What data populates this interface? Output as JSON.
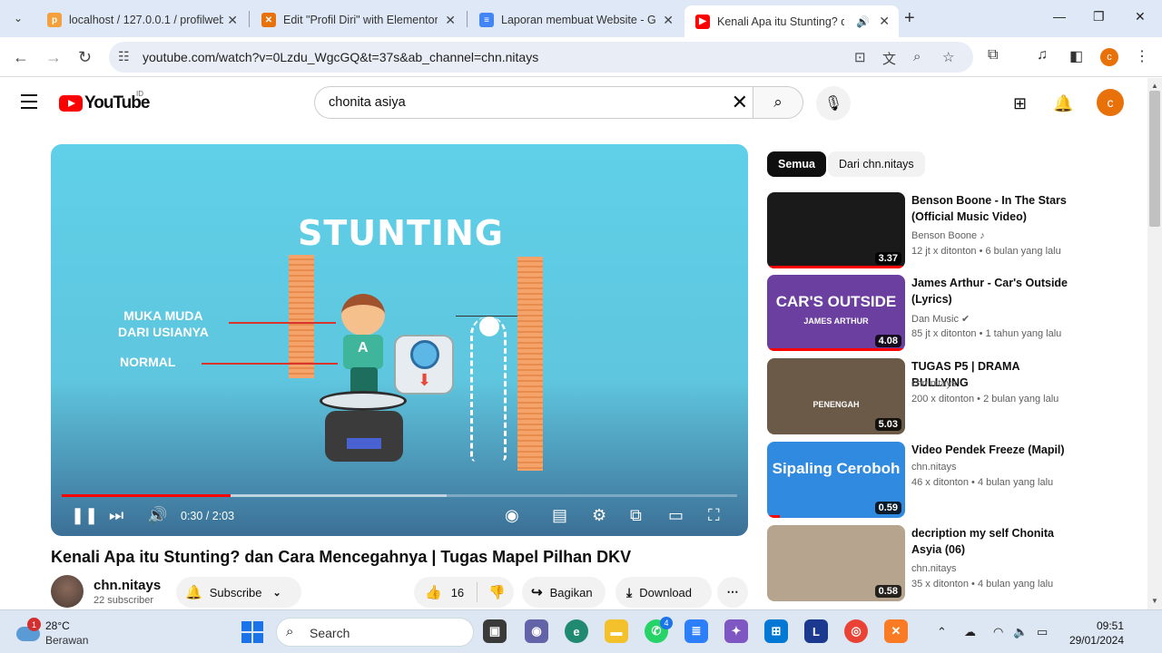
{
  "browser": {
    "tabs": [
      {
        "title": "localhost / 127.0.0.1 / profilweb",
        "favicon_color": "#f4a03c"
      },
      {
        "title": "Edit \"Profil Diri\" with Elementor",
        "favicon_color": "#e8710a"
      },
      {
        "title": "Laporan membuat Website - Go",
        "favicon_color": "#4285f4"
      },
      {
        "title": "Kenali Apa itu Stunting? dan",
        "favicon_color": "#ff0000"
      }
    ],
    "url": "youtube.com/watch?v=0Lzdu_WgcGQ&t=37s&ab_channel=chn.nitays",
    "profile_initial": "c"
  },
  "youtube": {
    "logo_text": "YouTube",
    "country_code": "ID",
    "search_query": "chonita asiya",
    "avatar_initial": "c"
  },
  "player": {
    "overlay_title": "STUNTING",
    "label_1": "MUKA MUDA\nDARI USIANYA",
    "label_2": "NORMAL",
    "kid_shirt_letter": "A",
    "time_display": "0:30 / 2:03",
    "played_fraction": 0.25,
    "buffered_fraction": 0.57
  },
  "video": {
    "title": "Kenali Apa itu Stunting? dan Cara Mencegahnya | Tugas Mapel Pilhan DKV",
    "channel": "chn.nitays",
    "subscribers": "22 subscriber",
    "subscribe_label": "Subscribe",
    "like_count": "16",
    "share_label": "Bagikan",
    "download_label": "Download"
  },
  "sidebar": {
    "chips": [
      "Semua",
      "Dari chn.nitays"
    ],
    "recommendations": [
      {
        "title": "Benson Boone - In The Stars (Official Music Video)",
        "channel": "Benson Boone",
        "channel_suffix": "♪",
        "meta": "12 jt x ditonton  • 6 bulan yang lalu",
        "duration": "3.37",
        "thumb_bg": "#1a1a1a",
        "thumb_text": ""
      },
      {
        "title": "James Arthur - Car's Outside (Lyrics)",
        "channel": "Dan Music",
        "channel_suffix": "✔",
        "meta": "85 jt x ditonton  • 1 tahun yang lalu",
        "duration": "4.08",
        "thumb_bg": "#6a3fa0",
        "thumb_text": "CAR'S OUTSIDE",
        "thumb_sub": "JAMES ARTHUR"
      },
      {
        "title": "TUGAS P5 | DRAMA BULLYING",
        "channel": "chn.nitays",
        "channel_suffix": "",
        "meta": "200 x ditonton  • 2 bulan yang lalu",
        "duration": "5.03",
        "thumb_bg": "#6b5a48",
        "thumb_text": "",
        "thumb_sub": "PENENGAH"
      },
      {
        "title": "Video Pendek Freeze (Mapil)",
        "channel": "chn.nitays",
        "channel_suffix": "",
        "meta": "46 x ditonton  • 4 bulan yang lalu",
        "duration": "0.59",
        "thumb_bg": "#2f8ae0",
        "thumb_text": "Sipaling Ceroboh",
        "thumb_sub": ""
      },
      {
        "title": "decription my self Chonita Asyia (06)",
        "channel": "chn.nitays",
        "channel_suffix": "",
        "meta": "35 x ditonton  • 4 bulan yang lalu",
        "duration": "0.58",
        "thumb_bg": "#b7a48e",
        "thumb_text": "",
        "thumb_sub": ""
      }
    ]
  },
  "taskbar": {
    "notification_count": "1",
    "temperature": "28°C",
    "condition": "Berawan",
    "search_label": "Search",
    "whatsapp_badge": "4",
    "time": "09:51",
    "date": "29/01/2024"
  }
}
